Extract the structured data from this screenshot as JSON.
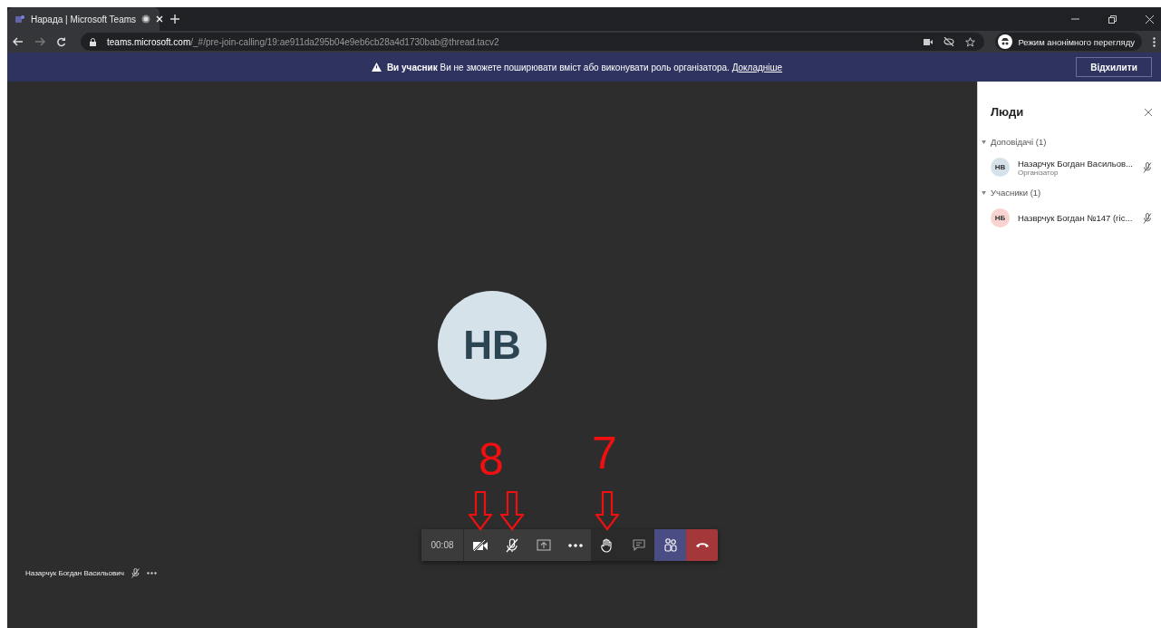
{
  "browser": {
    "tab_title": "Нарада | Microsoft Teams",
    "url_host": "teams.microsoft.com",
    "url_path": "/_#/pre-join-calling/19:ae911da295b04e9eb6cb28a4d1730bab@thread.tacv2",
    "incognito_label": "Режим анонімного перегляду"
  },
  "banner": {
    "role": "Ви учасник",
    "message": "Ви не зможете поширювати вміст або виконувати роль організатора.",
    "link": "Докладніше",
    "dismiss": "Відхилити"
  },
  "stage": {
    "avatar": "НВ",
    "self_name": "Назарчук Богдан Васильович"
  },
  "toolbar": {
    "timer": "00:08",
    "buttons": [
      {
        "kind": "camera-off",
        "selected": false,
        "marked": true
      },
      {
        "kind": "mic-off",
        "selected": false,
        "marked": true
      },
      {
        "kind": "share",
        "selected": false,
        "marked": false
      },
      {
        "kind": "more",
        "selected": false,
        "marked": false
      },
      {
        "kind": "hand",
        "selected": false,
        "marked": true
      },
      {
        "kind": "chat",
        "selected": false,
        "marked": false
      },
      {
        "kind": "people",
        "selected": true,
        "marked": false
      },
      {
        "kind": "hangup",
        "selected": false,
        "marked": false
      }
    ]
  },
  "annotations": [
    {
      "label": "8",
      "kind": "left"
    },
    {
      "label": "7",
      "kind": "right"
    }
  ],
  "panel": {
    "title": "Люди",
    "groups": [
      {
        "label": "Доповідачі (1)",
        "expanded": true,
        "people": [
          {
            "initials": "НВ",
            "name": "Назарчук Богдан Васильов...",
            "role": "Організатор",
            "color": "#d6e2ea"
          }
        ]
      },
      {
        "label": "Учасники (1)",
        "expanded": true,
        "people": [
          {
            "initials": "НБ",
            "name": "Назврчук Богдан №147 (гіс...",
            "color": "#f8d3cf"
          }
        ]
      }
    ]
  }
}
